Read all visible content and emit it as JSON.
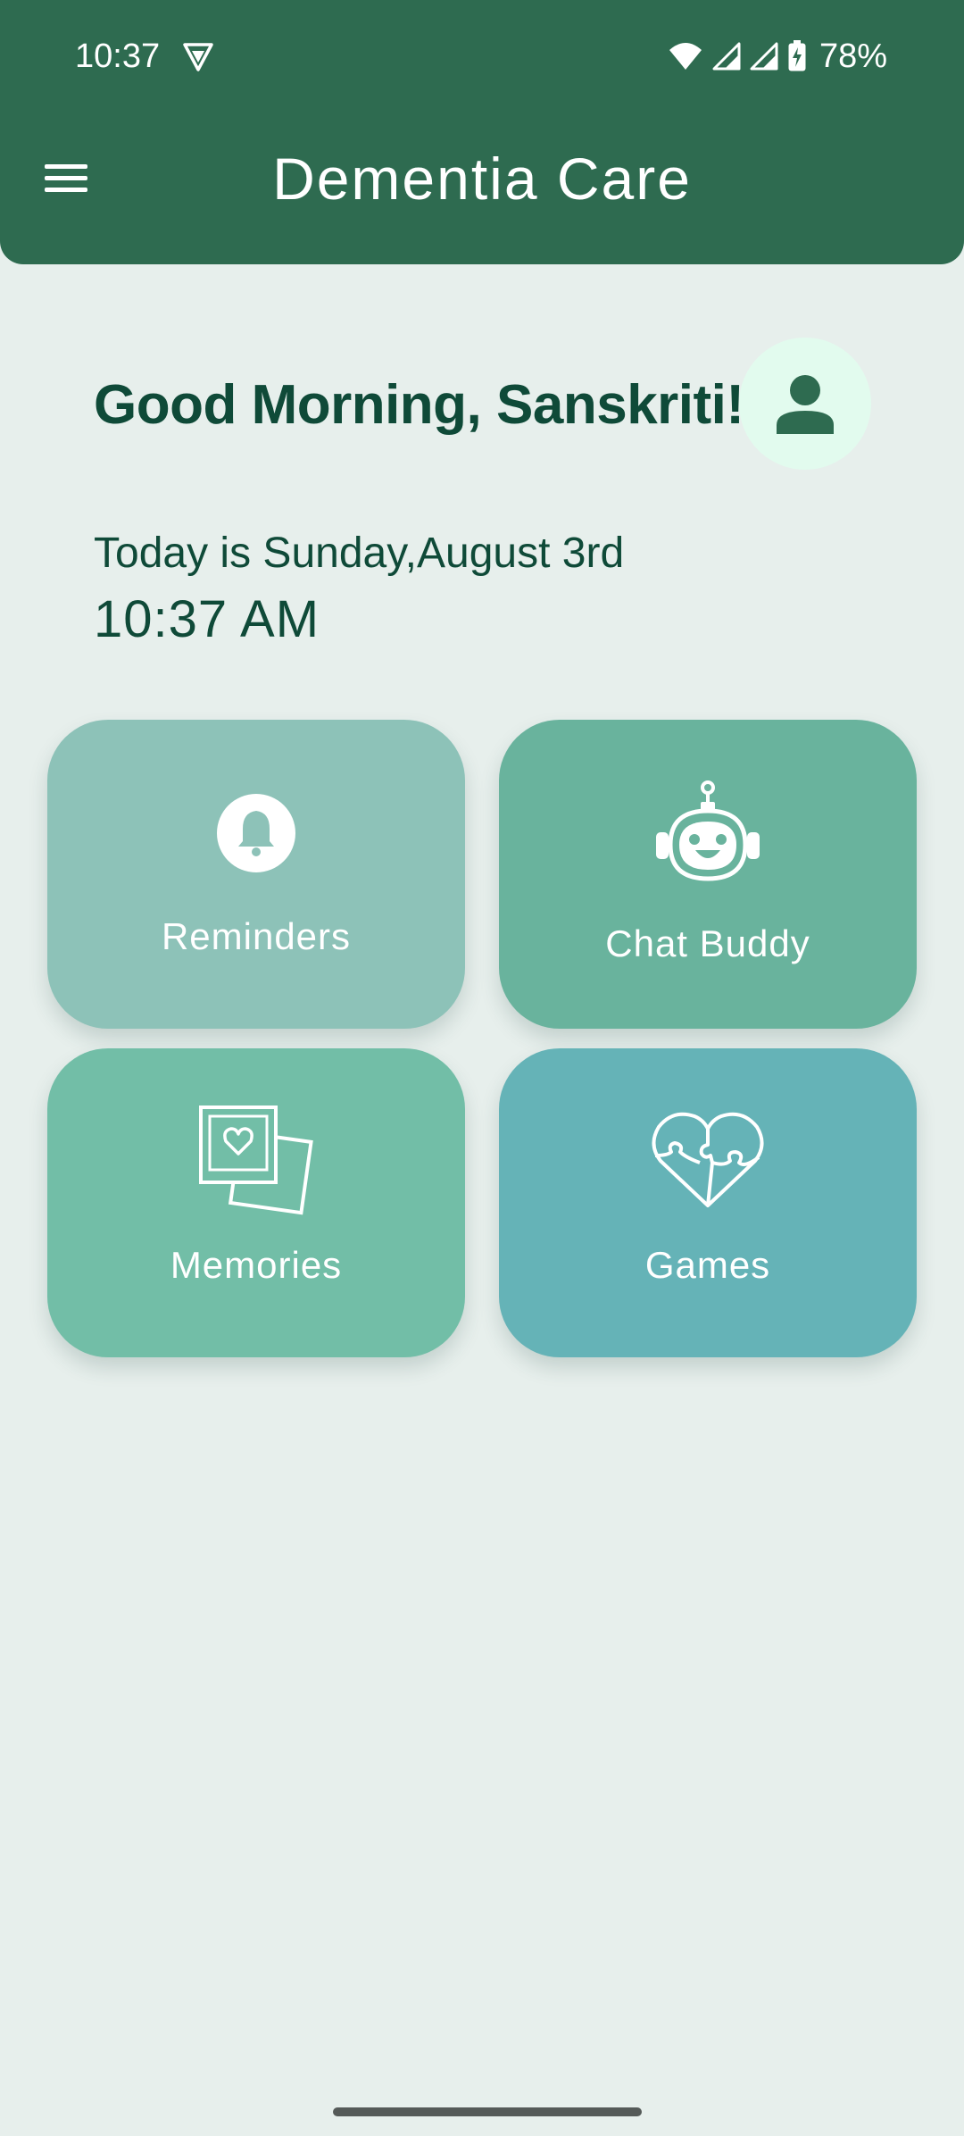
{
  "status_bar": {
    "time": "10:37",
    "battery_percent": "78%",
    "icons": [
      "vpn-icon",
      "wifi-icon",
      "signal-icon",
      "signal-icon",
      "battery-charging-icon"
    ]
  },
  "app_bar": {
    "title": "Dementia Care",
    "menu_icon": "menu-icon",
    "background_color": "#2e6b50"
  },
  "greeting": {
    "text": "Good Morning, Sanskriti!",
    "avatar_icon": "person-icon"
  },
  "date": {
    "line": "Today is Sunday,August 3rd",
    "time": "10:37 AM"
  },
  "cards": [
    {
      "label": "Reminders",
      "icon": "bell-icon",
      "color": "#8dc2b8"
    },
    {
      "label": "Chat Buddy",
      "icon": "robot-icon",
      "color": "#69b39d"
    },
    {
      "label": "Memories",
      "icon": "photos-heart-icon",
      "color": "#72bea7"
    },
    {
      "label": "Games",
      "icon": "puzzle-heart-icon",
      "color": "#65b3b7"
    }
  ]
}
